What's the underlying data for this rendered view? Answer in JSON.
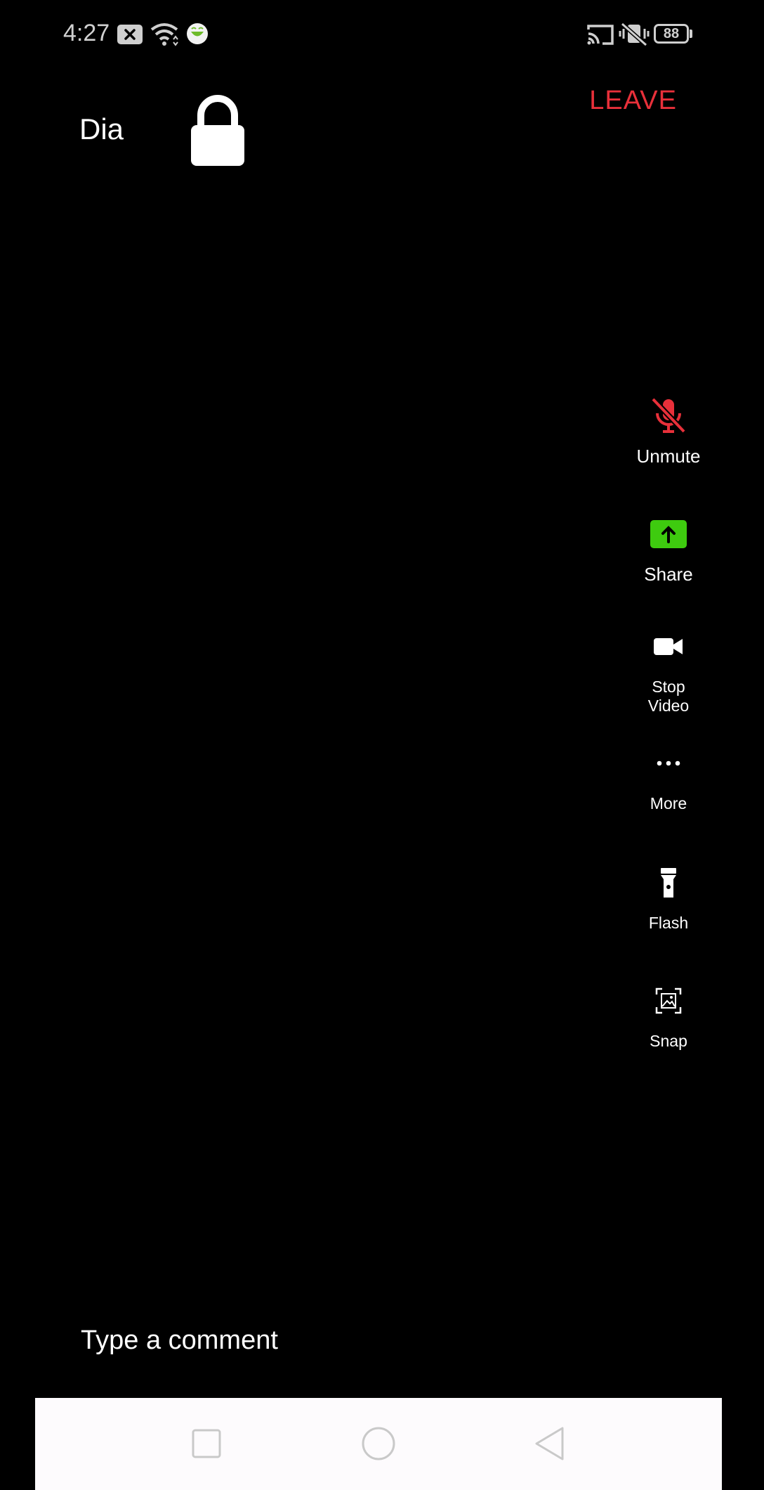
{
  "status_bar": {
    "time": "4:27",
    "battery": "88",
    "left_icons": [
      "notification-x-icon",
      "wifi-icon",
      "app-smiley-icon"
    ],
    "right_icons": [
      "cast-icon",
      "vibrate-off-icon",
      "battery-icon"
    ]
  },
  "header": {
    "meeting_name": "Dia",
    "lock_icon": "lock-icon",
    "leave_label": "LEAVE"
  },
  "controls": [
    {
      "label": "Unmute",
      "icon": "mic-muted-icon"
    },
    {
      "label": "Share",
      "icon": "share-screen-icon"
    },
    {
      "label": "Stop\nVideo",
      "icon": "video-camera-icon"
    },
    {
      "label": "More",
      "icon": "more-dots-icon"
    },
    {
      "label": "Flash",
      "icon": "flashlight-icon"
    },
    {
      "label": "Snap",
      "icon": "snapshot-icon"
    }
  ],
  "comment": {
    "placeholder": "Type a comment"
  },
  "nav_bar": {
    "icons": [
      "recents-square-icon",
      "home-circle-icon",
      "back-triangle-icon"
    ]
  },
  "colors": {
    "background": "#000000",
    "leave": "#e8303a",
    "muted_mic": "#e8303a",
    "share_green": "#3ecb0f",
    "nav_bar": "#fdfbfd"
  }
}
